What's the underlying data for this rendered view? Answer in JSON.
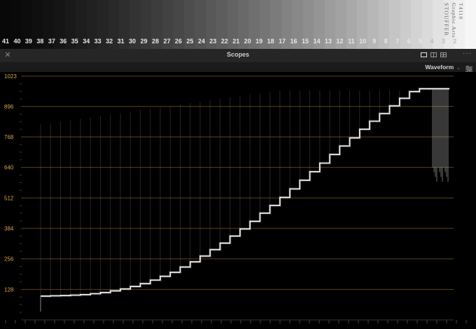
{
  "preview": {
    "step_numbers": [
      "41",
      "40",
      "39",
      "38",
      "37",
      "36",
      "35",
      "34",
      "33",
      "32",
      "31",
      "30",
      "29",
      "28",
      "27",
      "26",
      "25",
      "24",
      "23",
      "22",
      "21",
      "20",
      "19",
      "18",
      "17",
      "16",
      "15",
      "14",
      "13",
      "12",
      "11",
      "10",
      "9",
      "8",
      "7",
      "6",
      "5",
      "4",
      "3",
      "2"
    ],
    "brand_lines": [
      "STOUFFER",
      "Graphic Arts",
      "T4110"
    ]
  },
  "panel": {
    "title": "Scopes",
    "close_icon": "close-icon",
    "more_icon": "more-dots-icon",
    "layout_icons": [
      "single-view-icon",
      "dual-view-icon",
      "quad-view-icon"
    ]
  },
  "toolbar": {
    "scope_type": "Waveform",
    "dropdown_icon": "chevron-down-icon",
    "settings_icon": "settings-sliders-icon"
  },
  "colors": {
    "graticule": "#5a4318",
    "label": "#d9a44a",
    "trace": "#ffffff",
    "panel_bg": "#262626"
  },
  "chart_data": {
    "type": "waveform",
    "y_ticks": [
      1023,
      896,
      768,
      640,
      512,
      384,
      256,
      128
    ],
    "ylim": [
      0,
      1023
    ],
    "steps": 41,
    "step_values": [
      100,
      101,
      102,
      104,
      106,
      110,
      115,
      122,
      130,
      140,
      152,
      167,
      183,
      200,
      222,
      244,
      268,
      295,
      322,
      352,
      382,
      414,
      448,
      480,
      514,
      550,
      586,
      622,
      658,
      694,
      730,
      764,
      800,
      834,
      866,
      898,
      930,
      958,
      970,
      970,
      970
    ]
  }
}
